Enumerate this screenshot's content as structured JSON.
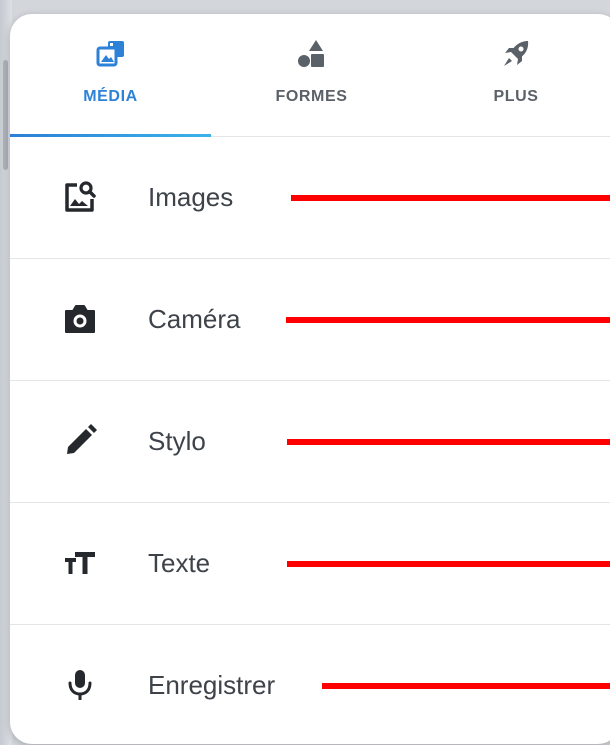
{
  "colors": {
    "accent": "#2d82d8",
    "annotation": "#ff0000",
    "icon": "#25282c",
    "tab_inactive": "#5b6168"
  },
  "tabs": [
    {
      "label": "MÉDIA",
      "icon": "media-gallery-icon",
      "active": true
    },
    {
      "label": "FORMES",
      "icon": "shapes-icon",
      "active": false
    },
    {
      "label": "PLUS",
      "icon": "rocket-icon",
      "active": false
    }
  ],
  "menu": {
    "items": [
      {
        "label": "Images",
        "icon": "image-search-icon"
      },
      {
        "label": "Caméra",
        "icon": "camera-icon"
      },
      {
        "label": "Stylo",
        "icon": "pencil-icon"
      },
      {
        "label": "Texte",
        "icon": "text-size-icon"
      },
      {
        "label": "Enregistrer",
        "icon": "microphone-icon"
      }
    ]
  }
}
